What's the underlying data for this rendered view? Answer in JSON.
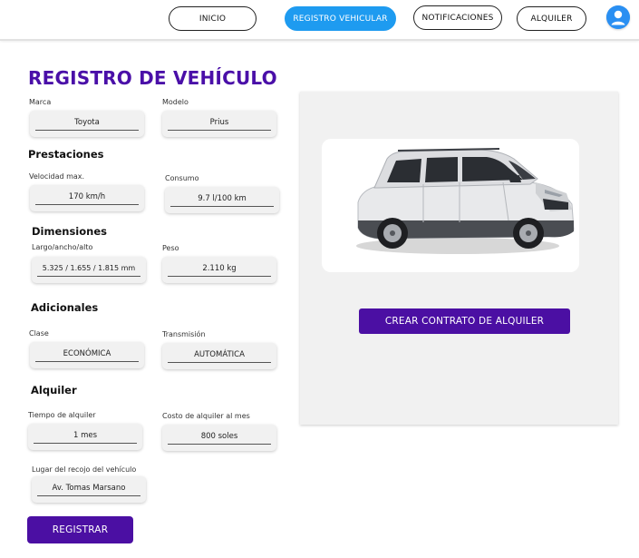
{
  "nav": {
    "inicio": "INICIO",
    "registro": "REGISTRO VEHICULAR",
    "notificaciones": "NOTIFICACIONES",
    "alquiler": "ALQUILER",
    "active_color": "#1e9bf0"
  },
  "page_title": "REGISTRO DE VEHÍCULO",
  "fields": {
    "marca": {
      "label": "Marca",
      "value": "Toyota"
    },
    "modelo": {
      "label": "Modelo",
      "value": "Prius"
    },
    "velocidad": {
      "label": "Velocidad max.",
      "value": "170 km/h"
    },
    "consumo": {
      "label": "Consumo",
      "value": "9.7 l/100 km"
    },
    "largo": {
      "label": "Largo/ancho/alto",
      "value": "5.325 / 1.655 / 1.815 mm"
    },
    "peso": {
      "label": "Peso",
      "value": "2.110 kg"
    },
    "clase": {
      "label": "Clase",
      "value": "ECONÓMICA"
    },
    "transmision": {
      "label": "Transmisión",
      "value": "AUTOMÁTICA"
    },
    "tiempo": {
      "label": "Tiempo de alquiler",
      "value": "1 mes"
    },
    "costo": {
      "label": "Costo de alquiler al mes",
      "value": "800 soles"
    },
    "lugar": {
      "label": "Lugar del recojo del vehículo",
      "value": "Av. Tomas Marsano"
    }
  },
  "sections": {
    "prestaciones": "Prestaciones",
    "dimensiones": "Dimensiones",
    "adicionales": "Adicionales",
    "alquiler": "Alquiler"
  },
  "buttons": {
    "crear_contrato": "CREAR CONTRATO DE ALQUILER",
    "registrar": "REGISTRAR"
  },
  "colors": {
    "brand": "#4b0fa3",
    "title": "#4a0fa8",
    "panel": "#f1f1f1"
  },
  "icons": {
    "avatar": "user-avatar-icon",
    "vehicle": "suv-vehicle-image"
  }
}
